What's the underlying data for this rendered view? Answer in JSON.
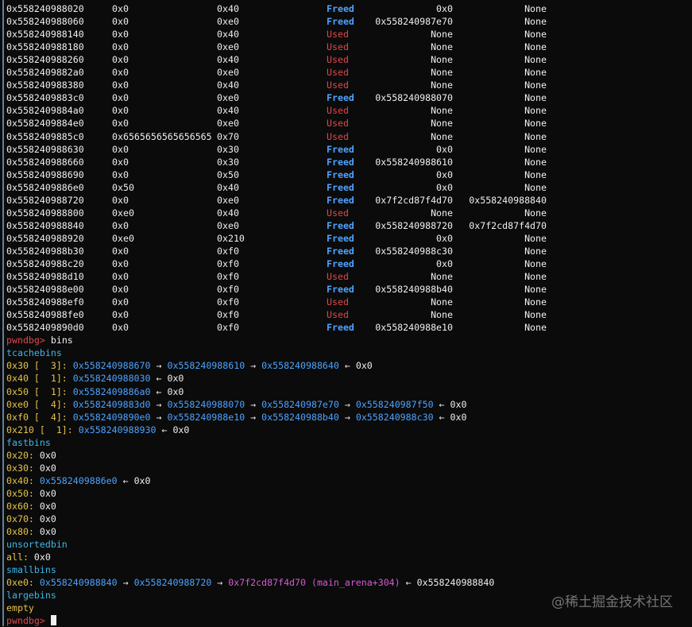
{
  "chunks": [
    {
      "addr": "0x558240988020",
      "prev": "0x0",
      "size": "0x40",
      "status": "Freed",
      "fd": "0x0",
      "bk": "None"
    },
    {
      "addr": "0x558240988060",
      "prev": "0x0",
      "size": "0xe0",
      "status": "Freed",
      "fd": "0x558240987e70",
      "bk": "None"
    },
    {
      "addr": "0x558240988140",
      "prev": "0x0",
      "size": "0x40",
      "status": "Used",
      "fd": "None",
      "bk": "None"
    },
    {
      "addr": "0x558240988180",
      "prev": "0x0",
      "size": "0xe0",
      "status": "Used",
      "fd": "None",
      "bk": "None"
    },
    {
      "addr": "0x558240988260",
      "prev": "0x0",
      "size": "0x40",
      "status": "Used",
      "fd": "None",
      "bk": "None"
    },
    {
      "addr": "0x5582409882a0",
      "prev": "0x0",
      "size": "0xe0",
      "status": "Used",
      "fd": "None",
      "bk": "None"
    },
    {
      "addr": "0x558240988380",
      "prev": "0x0",
      "size": "0x40",
      "status": "Used",
      "fd": "None",
      "bk": "None"
    },
    {
      "addr": "0x5582409883c0",
      "prev": "0x0",
      "size": "0xe0",
      "status": "Freed",
      "fd": "0x558240988070",
      "bk": "None"
    },
    {
      "addr": "0x5582409884a0",
      "prev": "0x0",
      "size": "0x40",
      "status": "Used",
      "fd": "None",
      "bk": "None"
    },
    {
      "addr": "0x5582409884e0",
      "prev": "0x0",
      "size": "0xe0",
      "status": "Used",
      "fd": "None",
      "bk": "None"
    },
    {
      "addr": "0x5582409885c0",
      "prev": "0x6565656565656565",
      "size": "0x70",
      "status": "Used",
      "fd": "None",
      "bk": "None"
    },
    {
      "addr": "0x558240988630",
      "prev": "0x0",
      "size": "0x30",
      "status": "Freed",
      "fd": "0x0",
      "bk": "None"
    },
    {
      "addr": "0x558240988660",
      "prev": "0x0",
      "size": "0x30",
      "status": "Freed",
      "fd": "0x558240988610",
      "bk": "None"
    },
    {
      "addr": "0x558240988690",
      "prev": "0x0",
      "size": "0x50",
      "status": "Freed",
      "fd": "0x0",
      "bk": "None"
    },
    {
      "addr": "0x5582409886e0",
      "prev": "0x50",
      "size": "0x40",
      "status": "Freed",
      "fd": "0x0",
      "bk": "None"
    },
    {
      "addr": "0x558240988720",
      "prev": "0x0",
      "size": "0xe0",
      "status": "Freed",
      "fd": "0x7f2cd87f4d70",
      "bk": "0x558240988840"
    },
    {
      "addr": "0x558240988800",
      "prev": "0xe0",
      "size": "0x40",
      "status": "Used",
      "fd": "None",
      "bk": "None"
    },
    {
      "addr": "0x558240988840",
      "prev": "0x0",
      "size": "0xe0",
      "status": "Freed",
      "fd": "0x558240988720",
      "bk": "0x7f2cd87f4d70"
    },
    {
      "addr": "0x558240988920",
      "prev": "0xe0",
      "size": "0x210",
      "status": "Freed",
      "fd": "0x0",
      "bk": "None"
    },
    {
      "addr": "0x558240988b30",
      "prev": "0x0",
      "size": "0xf0",
      "status": "Freed",
      "fd": "0x558240988c30",
      "bk": "None"
    },
    {
      "addr": "0x558240988c20",
      "prev": "0x0",
      "size": "0xf0",
      "status": "Freed",
      "fd": "0x0",
      "bk": "None"
    },
    {
      "addr": "0x558240988d10",
      "prev": "0x0",
      "size": "0xf0",
      "status": "Used",
      "fd": "None",
      "bk": "None"
    },
    {
      "addr": "0x558240988e00",
      "prev": "0x0",
      "size": "0xf0",
      "status": "Freed",
      "fd": "0x558240988b40",
      "bk": "None"
    },
    {
      "addr": "0x558240988ef0",
      "prev": "0x0",
      "size": "0xf0",
      "status": "Used",
      "fd": "None",
      "bk": "None"
    },
    {
      "addr": "0x558240988fe0",
      "prev": "0x0",
      "size": "0xf0",
      "status": "Used",
      "fd": "None",
      "bk": "None"
    },
    {
      "addr": "0x5582409890d0",
      "prev": "0x0",
      "size": "0xf0",
      "status": "Freed",
      "fd": "0x558240988e10",
      "bk": "None"
    }
  ],
  "prompt": "pwndbg>",
  "command": "bins",
  "tcache": {
    "header": "tcachebins",
    "rows": [
      {
        "size": "0x30",
        "count": "[  3]:",
        "chain": [
          "0x558240988670",
          "0x558240988610",
          "0x558240988640"
        ],
        "end": "0x0"
      },
      {
        "size": "0x40",
        "count": "[  1]:",
        "chain": [
          "0x558240988030"
        ],
        "end": "0x0"
      },
      {
        "size": "0x50",
        "count": "[  1]:",
        "chain": [
          "0x5582409886a0"
        ],
        "end": "0x0"
      },
      {
        "size": "0xe0",
        "count": "[  4]:",
        "chain": [
          "0x5582409883d0",
          "0x558240988070",
          "0x558240987e70",
          "0x558240987f50"
        ],
        "end": "0x0"
      },
      {
        "size": "0xf0",
        "count": "[  4]:",
        "chain": [
          "0x5582409890e0",
          "0x558240988e10",
          "0x558240988b40",
          "0x558240988c30"
        ],
        "end": "0x0"
      },
      {
        "size": "0x210",
        "count": "[  1]:",
        "chain": [
          "0x558240988930"
        ],
        "end": "0x0"
      }
    ]
  },
  "fastbins": {
    "header": "fastbins",
    "rows": [
      {
        "size": "0x20:",
        "value": "0x0"
      },
      {
        "size": "0x30:",
        "value": "0x0"
      },
      {
        "size": "0x40:",
        "chain": [
          "0x5582409886e0"
        ],
        "end": "0x0"
      },
      {
        "size": "0x50:",
        "value": "0x0"
      },
      {
        "size": "0x60:",
        "value": "0x0"
      },
      {
        "size": "0x70:",
        "value": "0x0"
      },
      {
        "size": "0x80:",
        "value": "0x0"
      }
    ]
  },
  "unsortedbin": {
    "header": "unsortedbin",
    "label": "all:",
    "value": "0x0"
  },
  "smallbins": {
    "header": "smallbins",
    "size": "0xe0:",
    "chain": [
      "0x558240988840",
      "0x558240988720"
    ],
    "arena": "0x7f2cd87f4d70 (main_arena+304)",
    "end": "0x558240988840"
  },
  "largebins": {
    "header": "largebins",
    "value": "empty"
  },
  "watermark": "@稀土掘金技术社区",
  "colors": {
    "freed": "#4da3ff",
    "used": "#e0464b",
    "address": "#4da3ff",
    "bin_size": "#e5c34a",
    "header": "#3fb6e6",
    "arena": "#d55bd2"
  }
}
